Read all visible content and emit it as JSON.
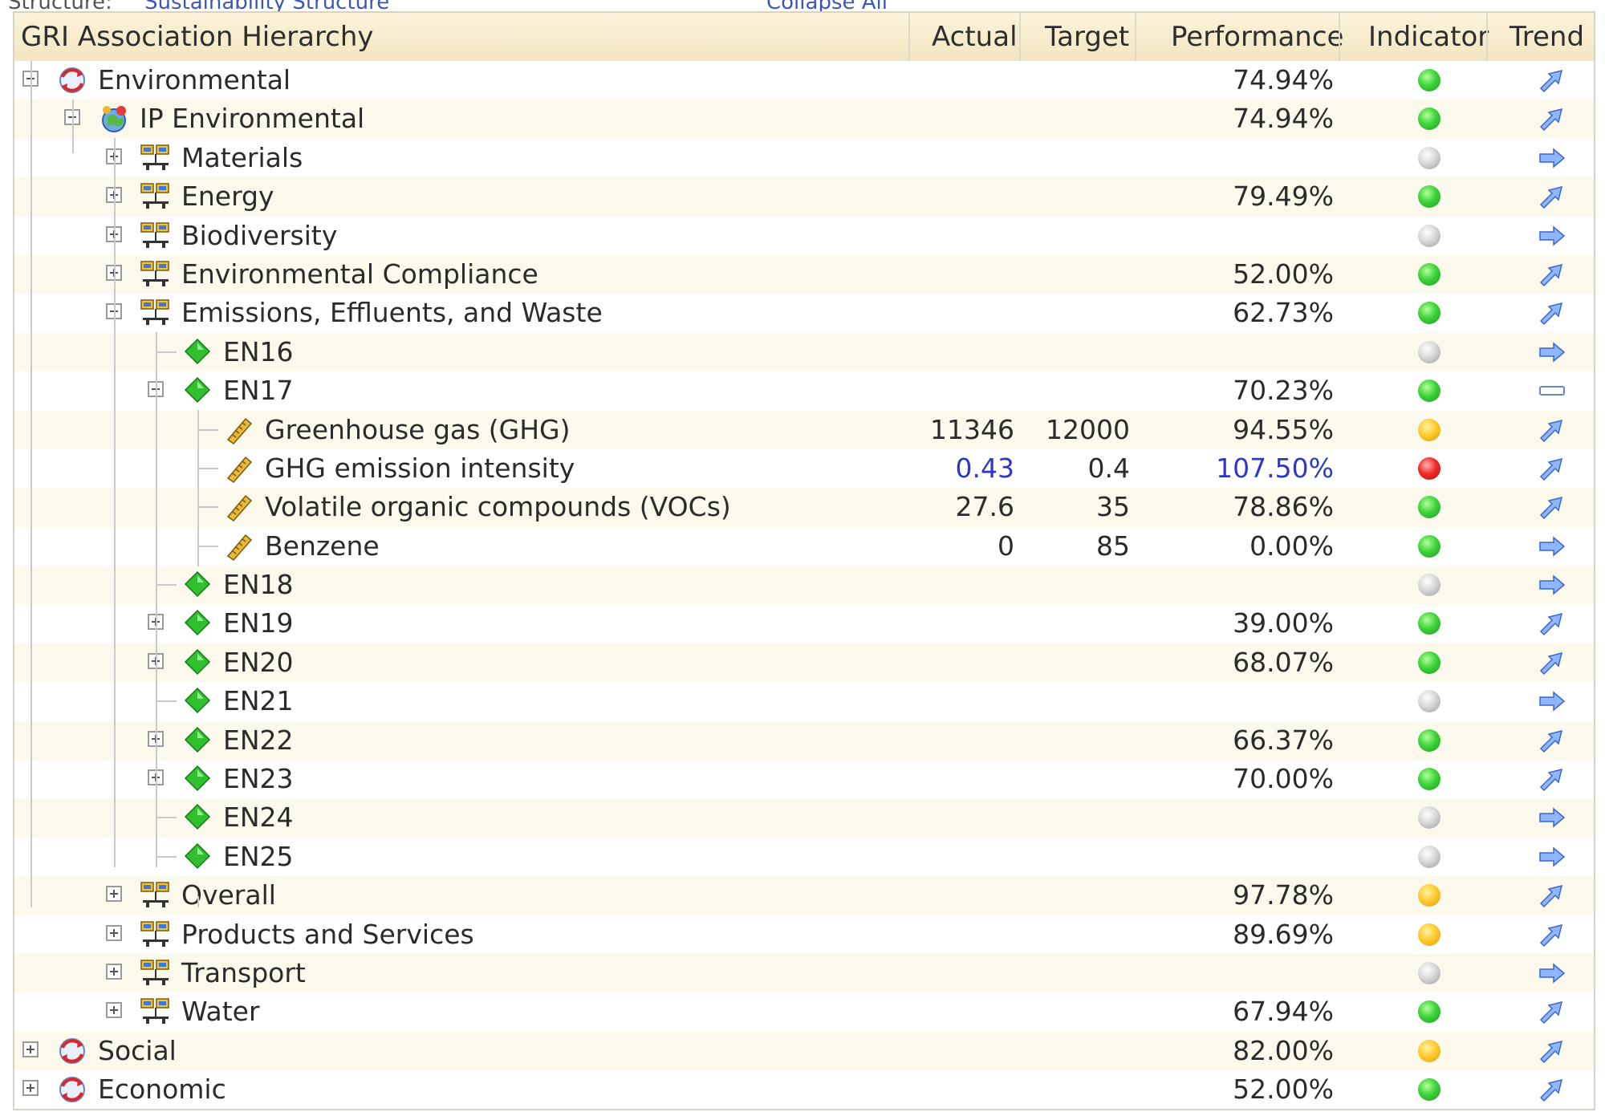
{
  "top_links": [
    "Structure:",
    "Sustainability Structure",
    "Collapse All"
  ],
  "header": {
    "hierarchy": "GRI Association Hierarchy",
    "actual": "Actual",
    "target": "Target",
    "performance": "Performance",
    "indicator": "Indicator",
    "trend": "Trend"
  },
  "colors": {
    "header_bg": "#f5ebcc",
    "row_alt": "#fbf8ec",
    "highlight_text": "#2f38c6",
    "indicator_green": "#3dd43a",
    "indicator_gray": "#cfcfcf",
    "indicator_yellow": "#ffca2e",
    "indicator_red": "#f02b2b"
  },
  "rows": [
    {
      "label": "Environmental",
      "level": 0,
      "toggle": "minus",
      "icon": "refresh-globe-icon",
      "actual": "",
      "target": "",
      "performance": "74.94%",
      "indicator": "green",
      "trend": "up-right"
    },
    {
      "label": "IP Environmental",
      "level": 1,
      "toggle": "minus",
      "icon": "globe-icon",
      "actual": "",
      "target": "",
      "performance": "74.94%",
      "indicator": "green",
      "trend": "up-right"
    },
    {
      "label": "Materials",
      "level": 2,
      "toggle": "plus",
      "icon": "network-icon",
      "actual": "",
      "target": "",
      "performance": "",
      "indicator": "gray",
      "trend": "right"
    },
    {
      "label": "Energy",
      "level": 2,
      "toggle": "plus",
      "icon": "network-icon",
      "actual": "",
      "target": "",
      "performance": "79.49%",
      "indicator": "green",
      "trend": "up-right"
    },
    {
      "label": "Biodiversity",
      "level": 2,
      "toggle": "plus",
      "icon": "network-icon",
      "actual": "",
      "target": "",
      "performance": "",
      "indicator": "gray",
      "trend": "right"
    },
    {
      "label": "Environmental Compliance",
      "level": 2,
      "toggle": "plus",
      "icon": "network-icon",
      "actual": "",
      "target": "",
      "performance": "52.00%",
      "indicator": "green",
      "trend": "up-right"
    },
    {
      "label": "Emissions, Effluents, and Waste",
      "level": 2,
      "toggle": "minus",
      "icon": "network-icon",
      "actual": "",
      "target": "",
      "performance": "62.73%",
      "indicator": "green",
      "trend": "up-right"
    },
    {
      "label": "EN16",
      "level": 3,
      "toggle": "none",
      "icon": "diamond-icon",
      "actual": "",
      "target": "",
      "performance": "",
      "indicator": "gray",
      "trend": "right"
    },
    {
      "label": "EN17",
      "level": 3,
      "toggle": "minus",
      "icon": "diamond-icon",
      "actual": "",
      "target": "",
      "performance": "70.23%",
      "indicator": "green",
      "trend": "flat"
    },
    {
      "label": "Greenhouse gas (GHG)",
      "level": 4,
      "toggle": "none",
      "icon": "ruler-icon",
      "actual": "11346",
      "target": "12000",
      "performance": "94.55%",
      "indicator": "yellow",
      "trend": "up-right"
    },
    {
      "label": "GHG emission intensity",
      "level": 4,
      "toggle": "none",
      "icon": "ruler-icon",
      "actual": "0.43",
      "target": "0.4",
      "performance": "107.50%",
      "indicator": "red",
      "trend": "up-right",
      "highlight": true
    },
    {
      "label": "Volatile organic compounds (VOCs)",
      "level": 4,
      "toggle": "none",
      "icon": "ruler-icon",
      "actual": "27.6",
      "target": "35",
      "performance": "78.86%",
      "indicator": "green",
      "trend": "up-right"
    },
    {
      "label": "Benzene",
      "level": 4,
      "toggle": "none",
      "icon": "ruler-icon",
      "actual": "0",
      "target": "85",
      "performance": "0.00%",
      "indicator": "green",
      "trend": "right"
    },
    {
      "label": "EN18",
      "level": 3,
      "toggle": "none",
      "icon": "diamond-icon",
      "actual": "",
      "target": "",
      "performance": "",
      "indicator": "gray",
      "trend": "right"
    },
    {
      "label": "EN19",
      "level": 3,
      "toggle": "plus",
      "icon": "diamond-icon",
      "actual": "",
      "target": "",
      "performance": "39.00%",
      "indicator": "green",
      "trend": "up-right"
    },
    {
      "label": "EN20",
      "level": 3,
      "toggle": "plus",
      "icon": "diamond-icon",
      "actual": "",
      "target": "",
      "performance": "68.07%",
      "indicator": "green",
      "trend": "up-right"
    },
    {
      "label": "EN21",
      "level": 3,
      "toggle": "none",
      "icon": "diamond-icon",
      "actual": "",
      "target": "",
      "performance": "",
      "indicator": "gray",
      "trend": "right"
    },
    {
      "label": "EN22",
      "level": 3,
      "toggle": "plus",
      "icon": "diamond-icon",
      "actual": "",
      "target": "",
      "performance": "66.37%",
      "indicator": "green",
      "trend": "up-right"
    },
    {
      "label": "EN23",
      "level": 3,
      "toggle": "plus",
      "icon": "diamond-icon",
      "actual": "",
      "target": "",
      "performance": "70.00%",
      "indicator": "green",
      "trend": "up-right"
    },
    {
      "label": "EN24",
      "level": 3,
      "toggle": "none",
      "icon": "diamond-icon",
      "actual": "",
      "target": "",
      "performance": "",
      "indicator": "gray",
      "trend": "right"
    },
    {
      "label": "EN25",
      "level": 3,
      "toggle": "none",
      "icon": "diamond-icon",
      "actual": "",
      "target": "",
      "performance": "",
      "indicator": "gray",
      "trend": "right"
    },
    {
      "label": "Overall",
      "level": 2,
      "toggle": "plus",
      "icon": "network-icon",
      "actual": "",
      "target": "",
      "performance": "97.78%",
      "indicator": "yellow",
      "trend": "up-right"
    },
    {
      "label": "Products and Services",
      "level": 2,
      "toggle": "plus",
      "icon": "network-icon",
      "actual": "",
      "target": "",
      "performance": "89.69%",
      "indicator": "yellow",
      "trend": "up-right"
    },
    {
      "label": "Transport",
      "level": 2,
      "toggle": "plus",
      "icon": "network-icon",
      "actual": "",
      "target": "",
      "performance": "",
      "indicator": "gray",
      "trend": "right"
    },
    {
      "label": "Water",
      "level": 2,
      "toggle": "plus",
      "icon": "network-icon",
      "actual": "",
      "target": "",
      "performance": "67.94%",
      "indicator": "green",
      "trend": "up-right"
    },
    {
      "label": "Social",
      "level": 0,
      "toggle": "plus",
      "icon": "refresh-globe-icon",
      "actual": "",
      "target": "",
      "performance": "82.00%",
      "indicator": "yellow",
      "trend": "up-right"
    },
    {
      "label": "Economic",
      "level": 0,
      "toggle": "plus",
      "icon": "refresh-globe-icon",
      "actual": "",
      "target": "",
      "performance": "52.00%",
      "indicator": "green",
      "trend": "up-right"
    }
  ]
}
